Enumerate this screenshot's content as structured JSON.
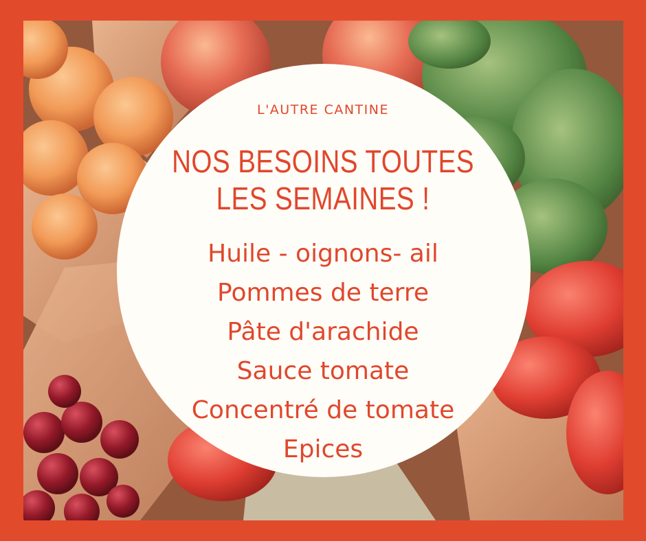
{
  "colors": {
    "frame": "#e24a2c",
    "text": "#e0472c",
    "circle": "#fffdf8"
  },
  "brand": "L'AUTRE CANTINE",
  "headline": [
    "NOS BESOINS TOUTES",
    "LES SEMAINES !"
  ],
  "items": [
    "Huile - oignons- ail",
    "Pommes de terre",
    "Pâte d'arachide",
    "Sauce tomate",
    "Concentré de tomate",
    "Epices"
  ]
}
